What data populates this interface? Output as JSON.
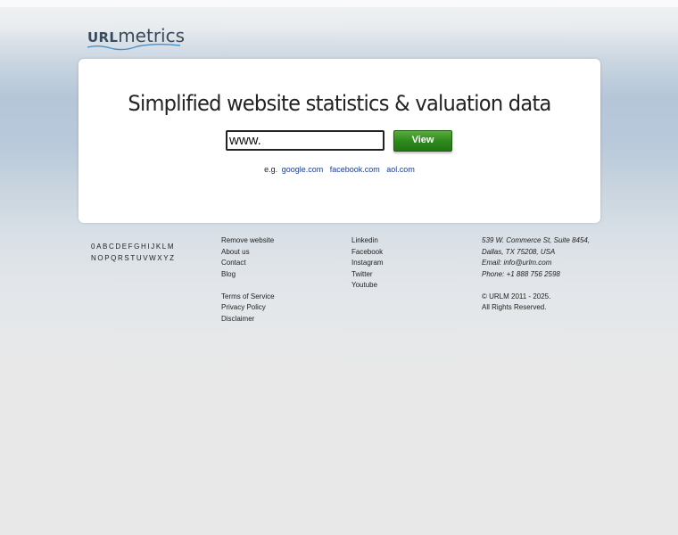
{
  "logo": {
    "part1": "URL",
    "part2": "metrics"
  },
  "hero": {
    "headline": "Simplified website statistics & valuation data",
    "input_value": "www.",
    "view_label": "View",
    "examples_prefix": "e.g.",
    "examples": [
      "google.com",
      "facebook.com",
      "aol.com"
    ]
  },
  "alphabet": {
    "row1": [
      "0",
      "A",
      "B",
      "C",
      "D",
      "E",
      "F",
      "G",
      "H",
      "I",
      "J",
      "K",
      "L",
      "M"
    ],
    "row2": [
      "N",
      "O",
      "P",
      "Q",
      "R",
      "S",
      "T",
      "U",
      "V",
      "W",
      "X",
      "Y",
      "Z"
    ]
  },
  "footer": {
    "col1": {
      "group1": [
        "Remove website",
        "About us",
        "Contact",
        "Blog"
      ],
      "group2": [
        "Terms of Service",
        "Privacy Policy",
        "Disclaimer"
      ]
    },
    "col2": [
      "Linkedin",
      "Facebook",
      "Instagram",
      "Twitter",
      "Youtube"
    ],
    "col3": {
      "address1": "539 W. Commerce St, Suite 8454,",
      "address2": "Dallas, TX 75208, USA",
      "email": "Email: info@urlm.com",
      "phone": "Phone: +1 888 756 2598",
      "copyright": "© URLM 2011 - 2025.",
      "rights": "All Rights Reserved."
    }
  },
  "colors": {
    "button_green": "#2f8a1e",
    "link_blue": "#1a3d8f",
    "logo_swoosh": "#4a90c8"
  }
}
